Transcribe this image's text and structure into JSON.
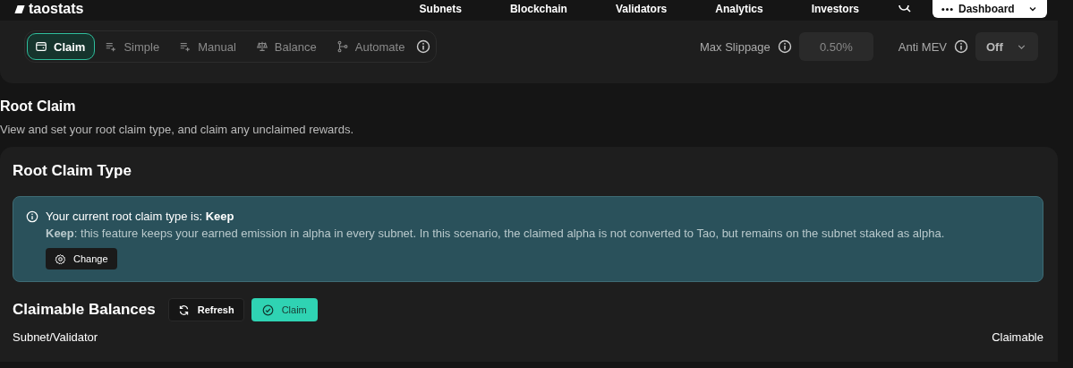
{
  "header": {
    "logo": "taostats",
    "nav": [
      "Subnets",
      "Blockchain",
      "Validators",
      "Analytics",
      "Investors"
    ],
    "dashboard_button": "Dashboard"
  },
  "toolbar": {
    "tabs": [
      {
        "label": "Claim",
        "selected": true
      },
      {
        "label": "Simple",
        "selected": false
      },
      {
        "label": "Manual",
        "selected": false
      },
      {
        "label": "Balance",
        "selected": false
      },
      {
        "label": "Automate",
        "selected": false
      }
    ],
    "max_slippage": {
      "label": "Max Slippage",
      "value": "0.50%"
    },
    "anti_mev": {
      "label": "Anti MEV",
      "value": "Off"
    }
  },
  "page": {
    "title": "Root Claim",
    "subtitle": "View and set your root claim type, and claim any unclaimed rewards."
  },
  "root_claim_type": {
    "title": "Root Claim Type",
    "alert_title": "Your current root claim type is: **Keep**",
    "alert_text": "**Keep**: this feature keeps your earned emission in alpha in every subnet. In this scenario, the claimed alpha is not converted to Tao, but remains on the subnet staked as alpha.",
    "change_button": "Change"
  },
  "claimable_balances": {
    "title": "Claimable Balances",
    "refresh_button": "Refresh",
    "claim_button": "Claim",
    "columns": [
      "Subnet/Validator",
      "Claimable"
    ]
  }
}
